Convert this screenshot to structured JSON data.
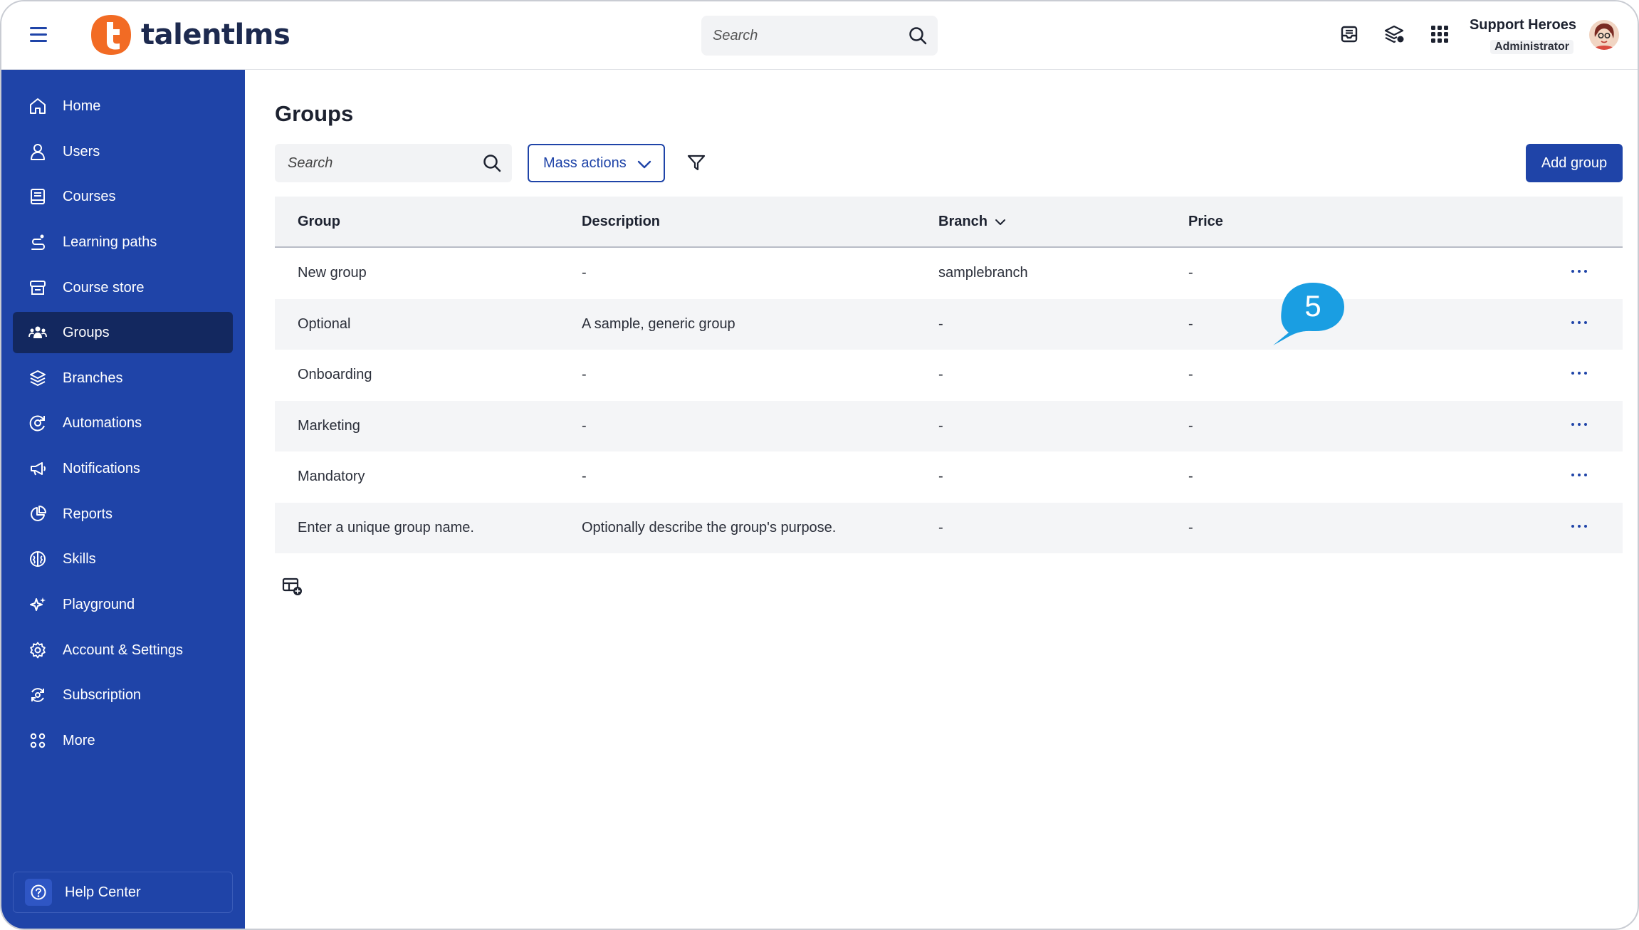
{
  "app": {
    "logo_text": "talentlms",
    "brand_color": "#1f44a8",
    "logo_color": "#f26b24"
  },
  "topbar": {
    "search_placeholder": "Search",
    "icons": [
      "menu-icon",
      "inbox-icon",
      "courses-switch-icon",
      "apps-grid-icon"
    ],
    "user_name": "Support Heroes",
    "user_role": "Administrator"
  },
  "sidebar": {
    "items": [
      {
        "label": "Home",
        "icon": "home-icon"
      },
      {
        "label": "Users",
        "icon": "user-icon"
      },
      {
        "label": "Courses",
        "icon": "book-icon"
      },
      {
        "label": "Learning paths",
        "icon": "path-icon"
      },
      {
        "label": "Course store",
        "icon": "store-icon"
      },
      {
        "label": "Groups",
        "icon": "groups-icon",
        "active": true
      },
      {
        "label": "Branches",
        "icon": "layers-icon"
      },
      {
        "label": "Automations",
        "icon": "automation-icon"
      },
      {
        "label": "Notifications",
        "icon": "megaphone-icon"
      },
      {
        "label": "Reports",
        "icon": "pie-chart-icon"
      },
      {
        "label": "Skills",
        "icon": "brain-icon"
      },
      {
        "label": "Playground",
        "icon": "sparkles-icon"
      },
      {
        "label": "Account & Settings",
        "icon": "gear-icon"
      },
      {
        "label": "Subscription",
        "icon": "subscription-icon"
      },
      {
        "label": "More",
        "icon": "grid-icon"
      }
    ],
    "help_label": "Help Center"
  },
  "main": {
    "title": "Groups",
    "search_placeholder": "Search",
    "mass_actions_label": "Mass actions",
    "add_button_label": "Add group",
    "columns": {
      "group": "Group",
      "description": "Description",
      "branch": "Branch",
      "price": "Price"
    },
    "rows": [
      {
        "group": "New group",
        "description": "-",
        "branch": "samplebranch",
        "price": "-"
      },
      {
        "group": "Optional",
        "description": "A sample, generic group",
        "branch": "-",
        "price": "-"
      },
      {
        "group": "Onboarding",
        "description": "-",
        "branch": "-",
        "price": "-"
      },
      {
        "group": "Marketing",
        "description": "-",
        "branch": "-",
        "price": "-"
      },
      {
        "group": "Mandatory",
        "description": "-",
        "branch": "-",
        "price": "-"
      },
      {
        "group": "Enter a unique group name.",
        "description": "Optionally describe the group's purpose.",
        "branch": "-",
        "price": "-"
      }
    ]
  },
  "annotation": {
    "step_number": "5",
    "color": "#1a9ee2"
  }
}
